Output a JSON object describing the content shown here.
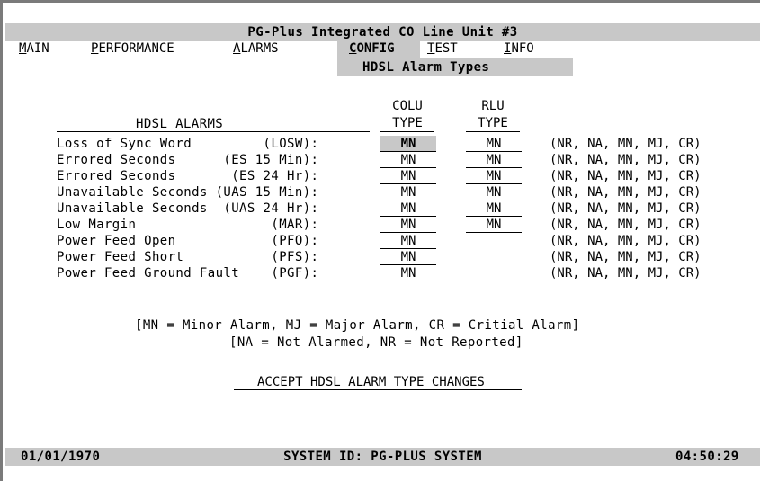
{
  "title": "PG-Plus Integrated CO Line Unit #3",
  "menu": [
    {
      "hot": "M",
      "rest": "AIN"
    },
    {
      "hot": "P",
      "rest": "ERFORMANCE"
    },
    {
      "hot": "A",
      "rest": "LARMS"
    },
    {
      "hot": "C",
      "rest": "ONFIG"
    },
    {
      "hot": "T",
      "rest": "EST"
    },
    {
      "hot": "I",
      "rest": "NFO"
    }
  ],
  "submenu_title": "HDSL Alarm Types",
  "table": {
    "section_header": "HDSL ALARMS",
    "colu_header": [
      "COLU",
      "TYPE"
    ],
    "rlu_header": [
      "RLU",
      "TYPE"
    ],
    "options": "(NR, NA, MN, MJ, CR)",
    "rows": [
      {
        "label": "Loss of Sync Word         (LOSW):",
        "colu": "MN",
        "rlu": "MN"
      },
      {
        "label": "Errored Seconds      (ES 15 Min):",
        "colu": "MN",
        "rlu": "MN"
      },
      {
        "label": "Errored Seconds       (ES 24 Hr):",
        "colu": "MN",
        "rlu": "MN"
      },
      {
        "label": "Unavailable Seconds (UAS 15 Min):",
        "colu": "MN",
        "rlu": "MN"
      },
      {
        "label": "Unavailable Seconds  (UAS 24 Hr):",
        "colu": "MN",
        "rlu": "MN"
      },
      {
        "label": "Low Margin                 (MAR):",
        "colu": "MN",
        "rlu": "MN"
      },
      {
        "label": "Power Feed Open            (PFO):",
        "colu": "MN"
      },
      {
        "label": "Power Feed Short           (PFS):",
        "colu": "MN"
      },
      {
        "label": "Power Feed Ground Fault    (PGF):",
        "colu": "MN"
      }
    ]
  },
  "legend": [
    "[MN = Minor Alarm, MJ = Major Alarm, CR = Critial Alarm]",
    "[NA = Not Alarmed, NR = Not Reported]"
  ],
  "accept_label": "ACCEPT HDSL ALARM TYPE CHANGES",
  "status": {
    "date": "01/01/1970",
    "system_id": "SYSTEM ID: PG-PLUS SYSTEM",
    "time": "04:50:29"
  }
}
